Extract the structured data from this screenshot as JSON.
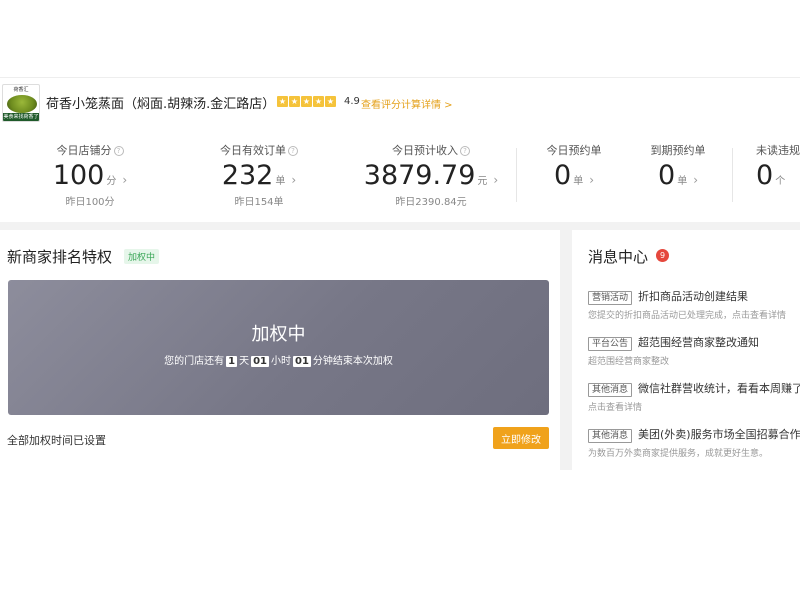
{
  "shop": {
    "logo_top_text": "荷香汇",
    "logo_bottom_text": "美食来找荷香了",
    "name": "荷香小笼蒸面（焖面.胡辣汤.金汇路店）",
    "rating": "4.9",
    "rating_link": "查看评分计算详情 >",
    "star_count": 5
  },
  "stats": [
    {
      "label": "今日店铺分",
      "value": "100",
      "unit": "分",
      "sub": "昨日100分",
      "help": true
    },
    {
      "label": "今日有效订单",
      "value": "232",
      "unit": "单",
      "sub": "昨日154单",
      "help": true
    },
    {
      "label": "今日预计收入",
      "value": "3879.79",
      "unit": "元",
      "sub": "昨日2390.84元",
      "help": true
    },
    {
      "label": "今日预约单",
      "value": "0",
      "unit": "单",
      "sub": "",
      "help": false
    },
    {
      "label": "到期预约单",
      "value": "0",
      "unit": "单",
      "sub": "",
      "help": false
    },
    {
      "label": "未读违规",
      "value": "0",
      "unit": "个",
      "sub": "",
      "help": false
    }
  ],
  "boost": {
    "title": "新商家排名特权",
    "badge": "加权中",
    "card_title": "加权中",
    "text_prefix": "您的门店还有",
    "days": "1",
    "days_unit": "天",
    "hours": "01",
    "hours_unit": "小时",
    "minutes": "01",
    "text_suffix": "分钟结束本次加权",
    "status": "全部加权时间已设置",
    "modify_label": "立即修改"
  },
  "messages": {
    "title": "消息中心",
    "count": "9",
    "items": [
      {
        "tag": "营销活动",
        "title": "折扣商品活动创建结果",
        "sub": "您提交的折扣商品活动已处理完成，点击查看详情"
      },
      {
        "tag": "平台公告",
        "title": "超范围经营商家整改通知",
        "sub": "超范围经营商家整改"
      },
      {
        "tag": "其他消息",
        "title": "微信社群营收统计，看看本周赚了多少",
        "sub": "点击查看详情"
      },
      {
        "tag": "其他消息",
        "title": "美团(外卖)服务市场全国招募合作伙伴",
        "sub": "为数百万外卖商家提供服务，成就更好生意。"
      }
    ]
  },
  "colors": {
    "accent": "#f0a21b",
    "star": "#f5c33b",
    "badge_green": "#3aa657",
    "count_red": "#e5483d"
  }
}
